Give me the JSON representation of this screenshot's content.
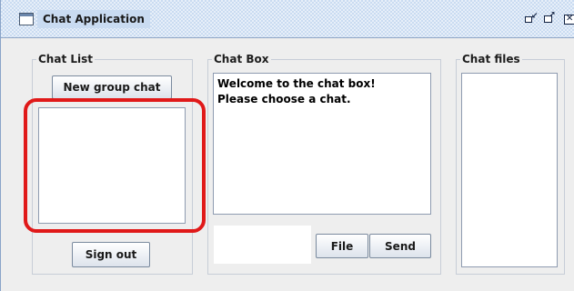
{
  "window": {
    "title": "Chat Application"
  },
  "panels": {
    "chat_list": {
      "title": "Chat List",
      "new_group_label": "New group chat",
      "sign_out_label": "Sign out"
    },
    "chat_box": {
      "title": "Chat Box",
      "messages": [
        "Welcome to the chat box!",
        "Please choose a chat."
      ],
      "input_value": "",
      "file_label": "File",
      "send_label": "Send"
    },
    "chat_files": {
      "title": "Chat files"
    }
  },
  "annotation": {
    "highlight_color": "#e01919"
  }
}
